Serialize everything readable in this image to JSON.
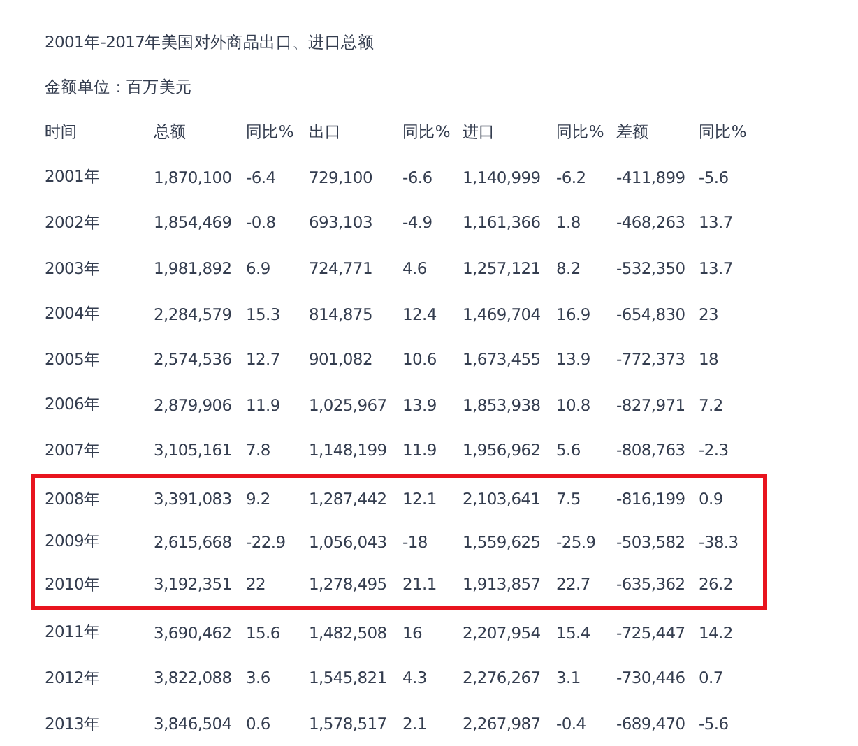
{
  "title": "2001年-2017年美国对外商品出口、进口总额",
  "unit_note": "金额单位：百万美元",
  "table": {
    "columns": [
      "时间",
      "总额",
      "同比%",
      "出口",
      "同比%",
      "进口",
      "同比%",
      "差额",
      "同比%"
    ],
    "rows": [
      {
        "cells": [
          "2001年",
          "1,870,100",
          "-6.4",
          "729,100",
          "-6.6",
          "1,140,999",
          "-6.2",
          "-411,899",
          "-5.6"
        ],
        "highlighted": false
      },
      {
        "cells": [
          "2002年",
          "1,854,469",
          "-0.8",
          "693,103",
          "-4.9",
          "1,161,366",
          "1.8",
          "-468,263",
          "13.7"
        ],
        "highlighted": false
      },
      {
        "cells": [
          "2003年",
          "1,981,892",
          "6.9",
          "724,771",
          "4.6",
          "1,257,121",
          "8.2",
          "-532,350",
          "13.7"
        ],
        "highlighted": false
      },
      {
        "cells": [
          "2004年",
          "2,284,579",
          "15.3",
          "814,875",
          "12.4",
          "1,469,704",
          "16.9",
          "-654,830",
          "23"
        ],
        "highlighted": false
      },
      {
        "cells": [
          "2005年",
          "2,574,536",
          "12.7",
          "901,082",
          "10.6",
          "1,673,455",
          "13.9",
          "-772,373",
          "18"
        ],
        "highlighted": false
      },
      {
        "cells": [
          "2006年",
          "2,879,906",
          "11.9",
          "1,025,967",
          "13.9",
          "1,853,938",
          "10.8",
          "-827,971",
          "7.2"
        ],
        "highlighted": false
      },
      {
        "cells": [
          "2007年",
          "3,105,161",
          "7.8",
          "1,148,199",
          "11.9",
          "1,956,962",
          "5.6",
          "-808,763",
          "-2.3"
        ],
        "highlighted": false
      },
      {
        "cells": [
          "2008年",
          "3,391,083",
          "9.2",
          "1,287,442",
          "12.1",
          "2,103,641",
          "7.5",
          "-816,199",
          "0.9"
        ],
        "highlighted": true
      },
      {
        "cells": [
          "2009年",
          "2,615,668",
          "-22.9",
          "1,056,043",
          "-18",
          "1,559,625",
          "-25.9",
          "-503,582",
          "-38.3"
        ],
        "highlighted": true
      },
      {
        "cells": [
          "2010年",
          "3,192,351",
          "22",
          "1,278,495",
          "21.1",
          "1,913,857",
          "22.7",
          "-635,362",
          "26.2"
        ],
        "highlighted": true
      },
      {
        "cells": [
          "2011年",
          "3,690,462",
          "15.6",
          "1,482,508",
          "16",
          "2,207,954",
          "15.4",
          "-725,447",
          "14.2"
        ],
        "highlighted": false
      },
      {
        "cells": [
          "2012年",
          "3,822,088",
          "3.6",
          "1,545,821",
          "4.3",
          "2,276,267",
          "3.1",
          "-730,446",
          "0.7"
        ],
        "highlighted": false
      },
      {
        "cells": [
          "2013年",
          "3,846,504",
          "0.6",
          "1,578,517",
          "2.1",
          "2,267,987",
          "-0.4",
          "-689,470",
          "-5.6"
        ],
        "highlighted": false
      }
    ]
  }
}
